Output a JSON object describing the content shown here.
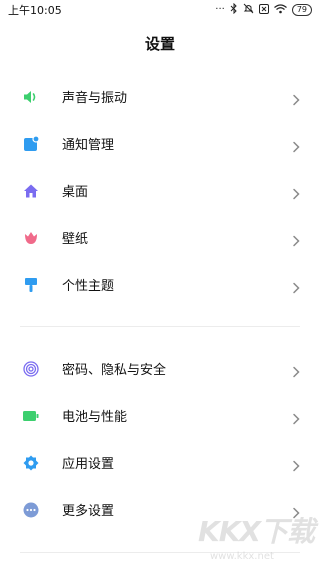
{
  "status": {
    "time": "上午10:05",
    "icons": [
      "signal-dots-icon",
      "bluetooth-icon",
      "silent-icon",
      "sim-x-icon",
      "wifi-icon"
    ],
    "battery": "79"
  },
  "header": {
    "title": "设置"
  },
  "groups": [
    {
      "items": [
        {
          "label": "声音与振动",
          "icon": "speaker-icon",
          "color": "#3ccf6e"
        },
        {
          "label": "通知管理",
          "icon": "notification-icon",
          "color": "#2f9cf0"
        },
        {
          "label": "桌面",
          "icon": "home-icon",
          "color": "#7a6cf0"
        },
        {
          "label": "壁纸",
          "icon": "tulip-icon",
          "color": "#f06a8a"
        },
        {
          "label": "个性主题",
          "icon": "brush-icon",
          "color": "#2f9cf0"
        }
      ]
    },
    {
      "items": [
        {
          "label": "密码、隐私与安全",
          "icon": "fingerprint-icon",
          "color": "#7a6cf0"
        },
        {
          "label": "电池与性能",
          "icon": "battery-icon",
          "color": "#3ccf6e"
        },
        {
          "label": "应用设置",
          "icon": "gear-icon",
          "color": "#2f9cf0"
        },
        {
          "label": "更多设置",
          "icon": "more-icon",
          "color": "#7d9bd6"
        }
      ]
    }
  ],
  "watermark": {
    "text": "KKX下载",
    "url": "www.kkx.net"
  }
}
